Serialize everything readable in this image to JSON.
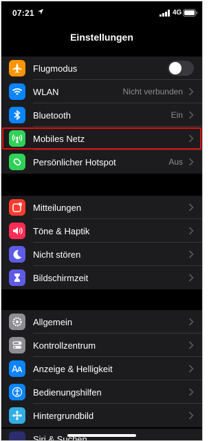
{
  "status": {
    "time": "07:21",
    "network": "4G"
  },
  "nav": {
    "title": "Einstellungen"
  },
  "groups": [
    {
      "rows": [
        {
          "label": "Flugmodus",
          "icon": "airplane-icon",
          "color": "#ff9500",
          "toggle_on": false
        },
        {
          "label": "WLAN",
          "value": "Nicht verbunden",
          "icon": "wifi-icon",
          "color": "#0a84ff"
        },
        {
          "label": "Bluetooth",
          "value": "Ein",
          "icon": "bluetooth-icon",
          "color": "#0a84ff"
        },
        {
          "label": "Mobiles Netz",
          "icon": "antenna-icon",
          "color": "#30d158",
          "highlighted": true
        },
        {
          "label": "Persönlicher Hotspot",
          "value": "Aus",
          "icon": "hotspot-icon",
          "color": "#30d158"
        }
      ]
    },
    {
      "rows": [
        {
          "label": "Mitteilungen",
          "icon": "notifications-icon",
          "color": "#ff3b30"
        },
        {
          "label": "Töne & Haptik",
          "icon": "speaker-icon",
          "color": "#ff2d55"
        },
        {
          "label": "Nicht stören",
          "icon": "moon-icon",
          "color": "#5e5ce6"
        },
        {
          "label": "Bildschirmzeit",
          "icon": "hourglass-icon",
          "color": "#5e5ce6"
        }
      ]
    },
    {
      "rows": [
        {
          "label": "Allgemein",
          "icon": "gear-icon",
          "color": "#8e8e93"
        },
        {
          "label": "Kontrollzentrum",
          "icon": "toggles-icon",
          "color": "#8e8e93"
        },
        {
          "label": "Anzeige & Helligkeit",
          "icon": "text-size-icon",
          "color": "#0a84ff"
        },
        {
          "label": "Bedienungshilfen",
          "icon": "accessibility-icon",
          "color": "#0a84ff"
        },
        {
          "label": "Hintergrundbild",
          "icon": "flower-icon",
          "color": "#32ade6"
        }
      ]
    }
  ],
  "partial_row": {
    "label": "Siri & Suchen",
    "icon": "siri-icon"
  }
}
